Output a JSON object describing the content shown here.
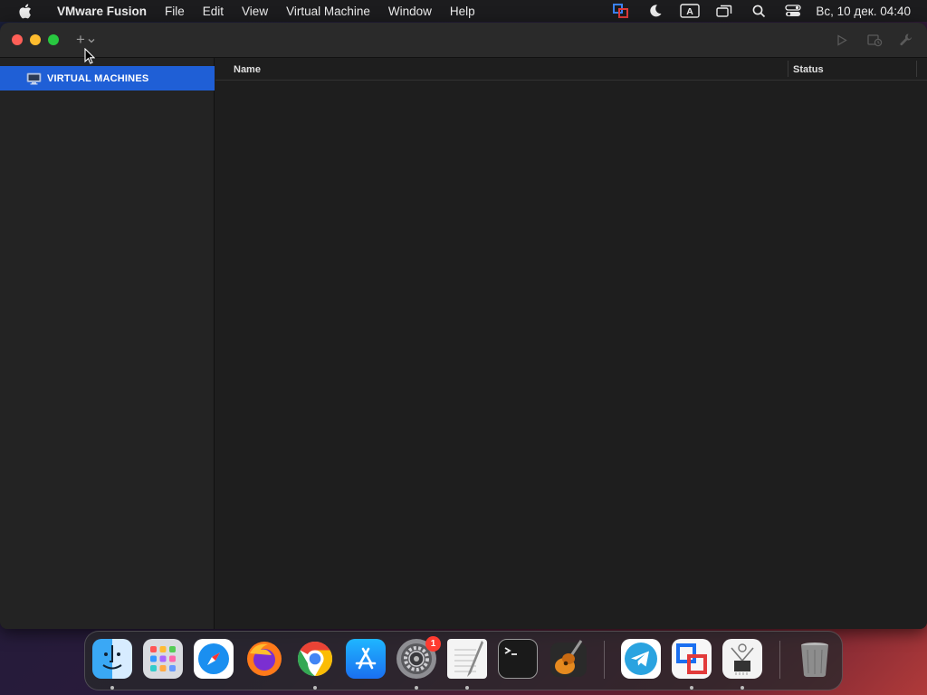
{
  "menubar": {
    "app_name": "VMware Fusion",
    "items": [
      "File",
      "Edit",
      "View",
      "Virtual Machine",
      "Window",
      "Help"
    ],
    "clock": "Вс, 10 дек.  04:40",
    "status_icons": [
      "vmware-fusion-menu-icon",
      "moon-icon",
      "input-source-icon",
      "screen-mirroring-icon",
      "search-icon",
      "control-center-icon"
    ],
    "input_source_label": "A"
  },
  "window": {
    "sidebar": {
      "items": [
        {
          "label": "VIRTUAL MACHINES",
          "selected": true
        }
      ]
    },
    "table": {
      "columns": [
        "Name",
        "Status"
      ],
      "rows": []
    },
    "toolbar": {
      "add_icon": "plus-icon",
      "buttons": [
        "play-icon",
        "snapshot-icon",
        "settings-wrench-icon"
      ]
    }
  },
  "dock": {
    "apps": [
      {
        "name": "Finder",
        "running": true
      },
      {
        "name": "Launchpad",
        "running": false
      },
      {
        "name": "Safari",
        "running": false
      },
      {
        "name": "Firefox",
        "running": false
      },
      {
        "name": "Chrome",
        "running": true
      },
      {
        "name": "App Store",
        "running": false
      },
      {
        "name": "System Settings",
        "running": true,
        "badge": "1"
      },
      {
        "name": "TextEdit",
        "running": true
      },
      {
        "name": "Terminal",
        "running": false
      },
      {
        "name": "GarageBand",
        "running": false
      },
      {
        "name": "Telegram",
        "running": false
      },
      {
        "name": "VMware Fusion",
        "running": true
      },
      {
        "name": "System Information",
        "running": true
      },
      {
        "name": "Trash",
        "running": false
      }
    ]
  },
  "colors": {
    "selection": "#1f5fd6",
    "window_bg": "#1e1e1e",
    "sidebar_bg": "#232323",
    "close": "#ff5f57",
    "minimize": "#febc2e",
    "maximize": "#28c840"
  }
}
